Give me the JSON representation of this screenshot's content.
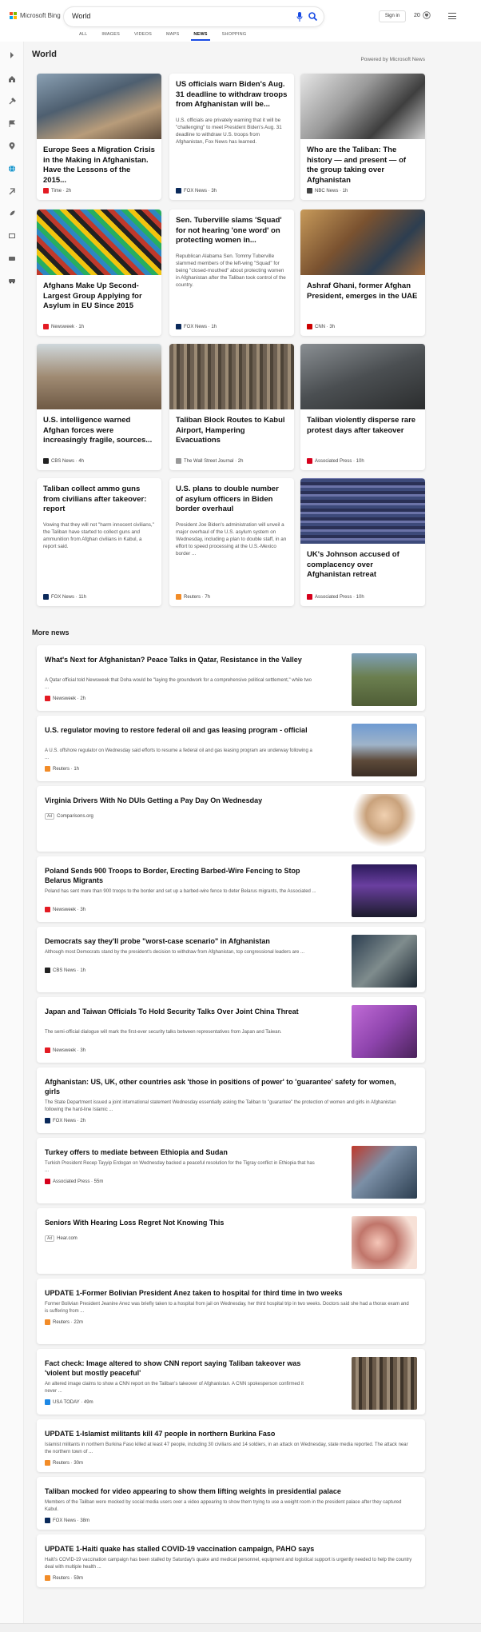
{
  "header": {
    "brand": "Microsoft Bing",
    "query": "World",
    "signin_label": "Sign in",
    "rewards_count": "20",
    "tabs": [
      "ALL",
      "IMAGES",
      "VIDEOS",
      "MAPS",
      "NEWS",
      "SHOPPING"
    ],
    "active_tab": "NEWS"
  },
  "colors": {
    "accent": "#174ae4",
    "brand_red": "#f25022",
    "brand_green": "#7fba00",
    "brand_blue": "#00a4ef",
    "brand_yellow": "#ffb900"
  },
  "rail_icons": [
    "expand-icon",
    "home-icon",
    "tools-icon",
    "flag-icon",
    "location-icon",
    "globe-icon",
    "briefcase-icon",
    "rocket-icon",
    "film-icon",
    "heart-icon",
    "car-icon"
  ],
  "main": {
    "section_title": "World",
    "powered_by": "Powered by Microsoft News",
    "cards": [
      {
        "title": "Europe Sees a Migration Crisis in the Making in Afghanistan. Have the Lessons of the 2015...",
        "snippet": "",
        "source": "Time",
        "age": "2h",
        "logo_color": "#e31b23"
      },
      {
        "title": "US officials warn Biden's Aug. 31 deadline to withdraw troops from Afghanistan will be...",
        "snippet": "U.S. officials are privately warning that it will be \"challenging\" to meet President Biden's Aug. 31 deadline to withdraw U.S. troops from Afghanistan, Fox News has learned.",
        "source": "FOX News",
        "age": "3h",
        "logo_color": "#0b2a5b"
      },
      {
        "title": "Who are the Taliban: The history — and present — of the group taking over Afghanistan",
        "snippet": "",
        "source": "NBC News",
        "age": "1h",
        "logo_color": "#444444"
      },
      {
        "title": "Afghans Make Up Second-Largest Group Applying for Asylum in EU Since 2015",
        "snippet": "",
        "source": "Newsweek",
        "age": "1h",
        "logo_color": "#e31b23"
      },
      {
        "title": "Sen. Tuberville slams 'Squad' for not hearing 'one word' on protecting women in...",
        "snippet": "Republican Alabama Sen. Tommy Tuberville slammed members of the left-wing \"Squad\" for being \"closed-mouthed\" about protecting women in Afghanistan after the Taliban took control of the country.",
        "source": "FOX News",
        "age": "1h",
        "logo_color": "#0b2a5b"
      },
      {
        "title": "Ashraf Ghani, former Afghan President, emerges in the UAE",
        "snippet": "",
        "source": "CNN",
        "age": "3h",
        "logo_color": "#cc0000"
      },
      {
        "title": "U.S. intelligence warned Afghan forces were increasingly fragile, sources...",
        "snippet": "",
        "source": "CBS News",
        "age": "4h",
        "logo_color": "#222222"
      },
      {
        "title": "Taliban Block Routes to Kabul Airport, Hampering Evacuations",
        "snippet": "",
        "source": "The Wall Street Journal",
        "age": "2h",
        "logo_color": "#999999"
      },
      {
        "title": "Taliban violently disperse rare protest days after takeover",
        "snippet": "",
        "source": "Associated Press",
        "age": "10h",
        "logo_color": "#d6001c"
      },
      {
        "title": "Taliban collect ammo guns from civilians after takeover: report",
        "snippet": "Vowing that they will not \"harm innocent civilians,\" the Taliban have started to collect guns and ammunition from Afghan civilians in Kabul, a report said.",
        "source": "FOX News",
        "age": "11h",
        "logo_color": "#0b2a5b"
      },
      {
        "title": "U.S. plans to double number of asylum officers in Biden border overhaul",
        "snippet": "President Joe Biden's administration will unveil a major overhaul of the U.S. asylum system on Wednesday, including a plan to double staff, in an effort to speed processing at the U.S.-Mexico border ...",
        "source": "Reuters",
        "age": "7h",
        "logo_color": "#f28c28"
      },
      {
        "title": "UK's Johnson accused of complacency over Afghanistan retreat",
        "snippet": "",
        "source": "Associated Press",
        "age": "10h",
        "logo_color": "#d6001c"
      }
    ]
  },
  "more_news": {
    "title": "More news",
    "items": [
      {
        "title": "What's Next for Afghanistan? Peace Talks in Qatar, Resistance in the Valley",
        "snippet": "A Qatar official told Newsweek that Doha would be \"laying the groundwork for a comprehensive political settlement,\" while two ...",
        "source": "Newsweek",
        "age": "2h",
        "logo_color": "#e31b23",
        "ad": ""
      },
      {
        "title": "U.S. regulator moving to restore federal oil and gas leasing program - official",
        "snippet": "A U.S. offshore regulator on Wednesday said efforts to resume a federal oil and gas leasing program are underway following a ...",
        "source": "Reuters",
        "age": "1h",
        "logo_color": "#f28c28",
        "ad": ""
      },
      {
        "title": "Virginia Drivers With No DUIs Getting a Pay Day On Wednesday",
        "snippet": "",
        "source": "Comparisons.org",
        "age": "",
        "logo_color": "",
        "ad": "Ad"
      },
      {
        "title": "Poland Sends 900 Troops to Border, Erecting Barbed-Wire Fencing to Stop Belarus Migrants",
        "snippet": "Poland has sent more than 900 troops to the border and set up a barbed-wire fence to deter Belarus migrants, the Associated ...",
        "source": "Newsweek",
        "age": "3h",
        "logo_color": "#e31b23",
        "ad": ""
      },
      {
        "title": "Democrats say they'll probe \"worst-case scenario\" in Afghanistan",
        "snippet": "Although most Democrats stand by the president's decision to withdraw from Afghanistan, top congressional leaders are ...",
        "source": "CBS News",
        "age": "1h",
        "logo_color": "#222222",
        "ad": ""
      },
      {
        "title": "Japan and Taiwan Officials To Hold Security Talks Over Joint China Threat",
        "snippet": "The semi-official dialogue will mark the first-ever security talks between representatives from Japan and Taiwan.",
        "source": "Newsweek",
        "age": "3h",
        "logo_color": "#e31b23",
        "ad": ""
      },
      {
        "title": "Afghanistan: US, UK, other countries ask 'those in positions of power' to 'guarantee' safety for women, girls",
        "snippet": "The State Department issued a joint international statement Wednesday essentially asking the Taliban to \"guarantee\" the protection of women and girls in Afghanistan following the hard-line Islamic ...",
        "source": "FOX News",
        "age": "2h",
        "logo_color": "#0b2a5b",
        "ad": ""
      },
      {
        "title": "Turkey offers to mediate between Ethiopia and Sudan",
        "snippet": "Turkish President Recep Tayyip Erdogan on Wednesday backed a peaceful resolution for the Tigray conflict in Ethiopia that has ...",
        "source": "Associated Press",
        "age": "55m",
        "logo_color": "#d6001c",
        "ad": ""
      },
      {
        "title": "Seniors With Hearing Loss Regret Not Knowing This",
        "snippet": "",
        "source": "Hear.com",
        "age": "",
        "logo_color": "",
        "ad": "Ad"
      },
      {
        "title": "UPDATE 1-Former Bolivian President Anez taken to hospital for third time in two weeks",
        "snippet": "Former Bolivian President Jeanine Anez was briefly taken to a hospital from jail on Wednesday, her third hospital trip in two weeks. Doctors said she had a thorax exam and is suffering from ...",
        "source": "Reuters",
        "age": "22m",
        "logo_color": "#f28c28",
        "ad": ""
      },
      {
        "title": "Fact check: Image altered to show CNN report saying Taliban takeover was 'violent but mostly peaceful'",
        "snippet": "An altered image claims to show a CNN report on the Taliban's takeover of Afghanistan. A CNN spokesperson confirmed it never ...",
        "source": "USA TODAY",
        "age": "49m",
        "logo_color": "#1e88e5",
        "ad": ""
      },
      {
        "title": "UPDATE 1-Islamist militants kill 47 people in northern Burkina Faso",
        "snippet": "Islamist militants in northern Burkina Faso killed at least 47 people, including 30 civilians and 14 soldiers, in an attack on Wednesday, state media reported. The attack near the northern town of ...",
        "source": "Reuters",
        "age": "30m",
        "logo_color": "#f28c28",
        "ad": ""
      },
      {
        "title": "Taliban mocked for video appearing to show them lifting weights in presidential palace",
        "snippet": "Members of the Taliban were mocked by social media users over a video appearing to show them trying to use a weight room in the president palace after they captured Kabul.",
        "source": "FOX News",
        "age": "38m",
        "logo_color": "#0b2a5b",
        "ad": ""
      },
      {
        "title": "UPDATE 1-Haiti quake has stalled COVID-19 vaccination campaign, PAHO says",
        "snippet": "Haiti's COVID-19 vaccination campaign has been stalled by Saturday's quake and medical personnel, equipment and logistical support is urgently needed to help the country deal with multiple health ...",
        "source": "Reuters",
        "age": "59m",
        "logo_color": "#f28c28",
        "ad": ""
      }
    ]
  }
}
